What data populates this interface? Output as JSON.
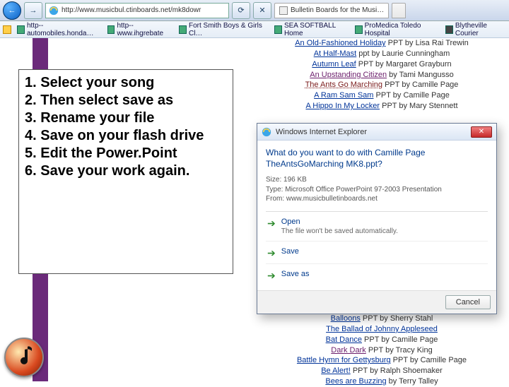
{
  "browser": {
    "url": "http://www.musicbul.ctinboards.net/mk8dowr",
    "tabs": [
      {
        "label": "Bulletin Boards for the Musi…"
      },
      {
        "label": ""
      }
    ]
  },
  "bookmarks": [
    "http--automobiles.honda…",
    "http--www.ihgrebate",
    "Fort Smith Boys & Girls Cl…",
    "SEA SOFTBALL Home",
    "ProMedica Toledo Hospital",
    "Blytheville Courier"
  ],
  "instructions": [
    "1. Select your song",
    "2. Then select  save as",
    "3. Rename your file",
    "4. Save on your flash drive",
    "5. Edit the Power.Point",
    "6. Save your work again."
  ],
  "songs_top": [
    {
      "title": "An Old-Fashioned Holiday",
      "meta": " PPT by Lisa Rai Trewin",
      "cls": "song-link"
    },
    {
      "title": "At Half-Mast",
      "meta": " ppt by Laurie Cunningham",
      "cls": "song-link"
    },
    {
      "title": "Autumn Leaf",
      "meta": " PPT by Margaret Grayburn",
      "cls": "song-link"
    },
    {
      "title": "An Upstanding Citizen",
      "meta": " by Tami Mangusso",
      "cls": "song-link visited"
    },
    {
      "title": "The Ants Go Marching",
      "meta": " PPT by Camille Page",
      "cls": "song-link sel"
    },
    {
      "title": "A Ram Sam Sam",
      "meta": " PPT by Camille Page",
      "cls": "song-link"
    },
    {
      "title": "A Hippo In My Locker",
      "meta": " PPT by Mary Stennett",
      "cls": "song-link"
    }
  ],
  "songs_bottom": [
    {
      "title": "Balloons",
      "meta": " PPT by Sherry Stahl",
      "cls": "song-link"
    },
    {
      "title": "The Ballad of Johnny Appleseed",
      "meta": "",
      "cls": "song-link"
    },
    {
      "title": "Bat Dance",
      "meta": " PPT by Camille Page",
      "cls": "song-link"
    },
    {
      "title": "Dark Dark",
      "meta": " PPT by Tracy King",
      "cls": "song-link visited"
    },
    {
      "title": "Battle Hymn for Gettysburg",
      "meta": " PPT by Camille Page",
      "cls": "song-link"
    },
    {
      "title": "Be Alert!",
      "meta": " PPT by Ralph Shoemaker",
      "cls": "song-link"
    },
    {
      "title": "Bees are Buzzing",
      "meta": " by Terry Talley",
      "cls": "song-link"
    }
  ],
  "dialog": {
    "title": "Windows Internet Explorer",
    "question_l1": "What do you want to do with Camille Page",
    "question_l2": "TheAntsGoMarching MK8.ppt?",
    "size_label": "Size: ",
    "size": "196 KB",
    "type_label": "Type: ",
    "type": "Microsoft Office PowerPoint 97-2003 Presentation",
    "from_label": "From: ",
    "from": "www.musicbulletinboards.net",
    "options": [
      {
        "t": "Open",
        "s": "The file won't be saved automatically."
      },
      {
        "t": "Save",
        "s": ""
      },
      {
        "t": "Save as",
        "s": ""
      }
    ],
    "cancel": "Cancel"
  }
}
